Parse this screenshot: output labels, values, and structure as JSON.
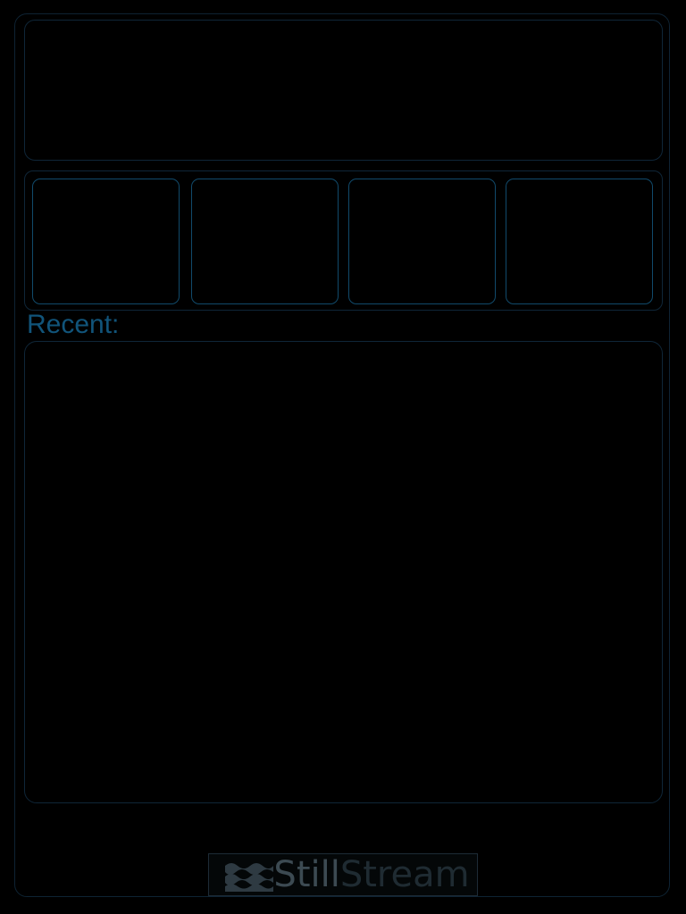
{
  "recent": {
    "label": "Recent:",
    "items": []
  },
  "buttons": [
    {
      "label": ""
    },
    {
      "label": ""
    },
    {
      "label": ""
    },
    {
      "label": ""
    }
  ],
  "logo": {
    "part_1": "Still",
    "part_2": "Stream"
  },
  "colors": {
    "background": "#000000",
    "accent": "#11547a",
    "panel_border": "#0f2638"
  }
}
